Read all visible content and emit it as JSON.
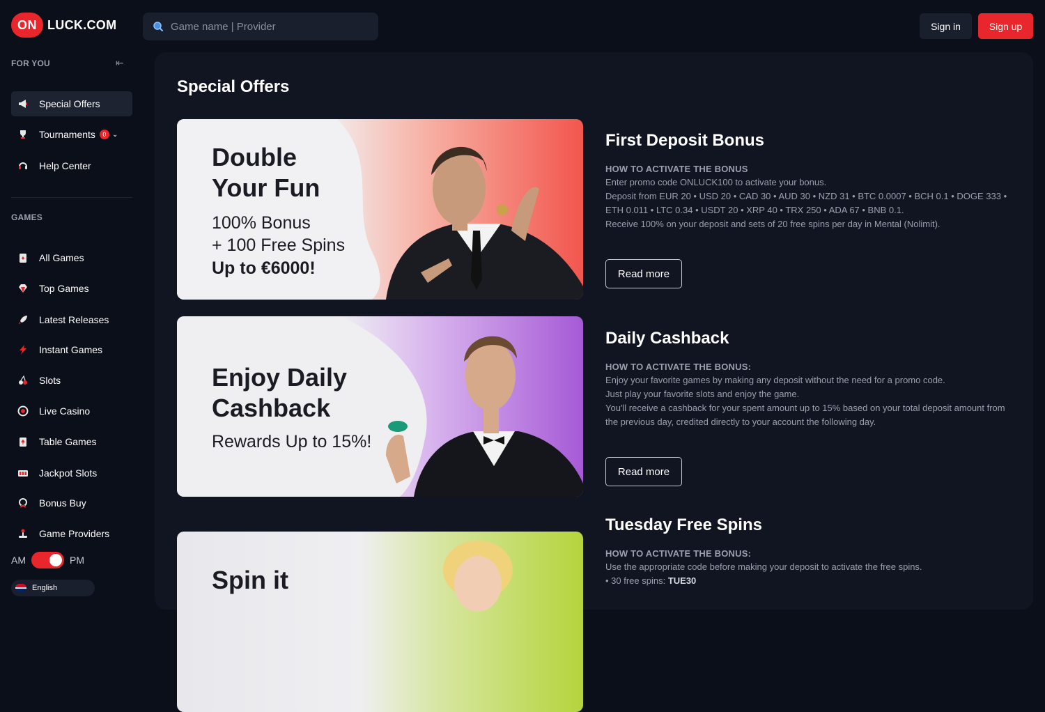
{
  "header": {
    "logo_badge": "ON",
    "logo_text": "LUCK.COM",
    "search_placeholder": "Game name | Provider",
    "signin": "Sign in",
    "signup": "Sign up"
  },
  "sidebar": {
    "for_you_label": "FOR YOU",
    "for_you_items": [
      {
        "label": "Special Offers",
        "icon": "megaphone-icon"
      },
      {
        "label": "Tournaments",
        "icon": "trophy-icon",
        "badge": "0"
      },
      {
        "label": "Help Center",
        "icon": "headset-icon"
      }
    ],
    "games_label": "GAMES",
    "games_items": [
      {
        "label": "All Games",
        "icon": "cards-icon"
      },
      {
        "label": "Top Games",
        "icon": "diamond-icon"
      },
      {
        "label": "Latest Releases",
        "icon": "rocket-icon"
      },
      {
        "label": "Instant Games",
        "icon": "lightning-icon"
      },
      {
        "label": "Slots",
        "icon": "cherries-icon"
      },
      {
        "label": "Live Casino",
        "icon": "roulette-icon"
      },
      {
        "label": "Table Games",
        "icon": "card-table-icon"
      },
      {
        "label": "Jackpot Slots",
        "icon": "slot-machine-icon"
      },
      {
        "label": "Bonus Buy",
        "icon": "medal-icon"
      },
      {
        "label": "Game Providers",
        "icon": "joystick-icon"
      }
    ],
    "am": "AM",
    "pm": "PM",
    "language": "English"
  },
  "main": {
    "title": "Special Offers",
    "offers": [
      {
        "banner_headline_1": "Double",
        "banner_headline_2": "Your Fun",
        "banner_sub_1": "100% Bonus",
        "banner_sub_2": "+ 100 Free Spins",
        "banner_bold": "Up to €6000!",
        "title": "First Deposit Bonus",
        "how": "HOW TO ACTIVATE THE BONUS",
        "lines": [
          "Enter promo code ONLUCK100 to activate your bonus.",
          "Deposit from EUR 20 • USD 20 • CAD 30 • AUD 30 • NZD 31 • BTC 0.0007 • BCH 0.1 • DOGE 333 • ETH 0.011 • LTC 0.34 • USDT 20 • XRP 40 • TRX 250 • ADA 67 • BNB 0.1.",
          "Receive 100% on your deposit and sets of 20 free spins per day in Mental (Nolimit)."
        ],
        "read_more": "Read more"
      },
      {
        "banner_headline_1": "Enjoy Daily",
        "banner_headline_2": "Cashback",
        "banner_sub_1": "Rewards Up to 15%!",
        "title": "Daily Cashback",
        "how": "HOW TO ACTIVATE THE BONUS:",
        "lines": [
          "Enjoy your favorite games by making any deposit without the need for a promo code.",
          "Just play your favorite slots and enjoy the game.",
          "You'll receive a cashback for your spent amount up to 15% based on your total deposit amount from the previous day, credited directly to your account the following day."
        ],
        "read_more": "Read more"
      },
      {
        "banner_headline_1": "Spin it",
        "title": "Tuesday Free Spins",
        "how": "HOW TO ACTIVATE THE BONUS:",
        "lines": [
          "Use the appropriate code before making your deposit to activate the free spins."
        ],
        "code_prefix": "• 30 free spins: ",
        "code": "TUE30"
      }
    ]
  },
  "colors": {
    "accent": "#e8262b",
    "background": "#0b0f1a",
    "panel": "#111522"
  }
}
